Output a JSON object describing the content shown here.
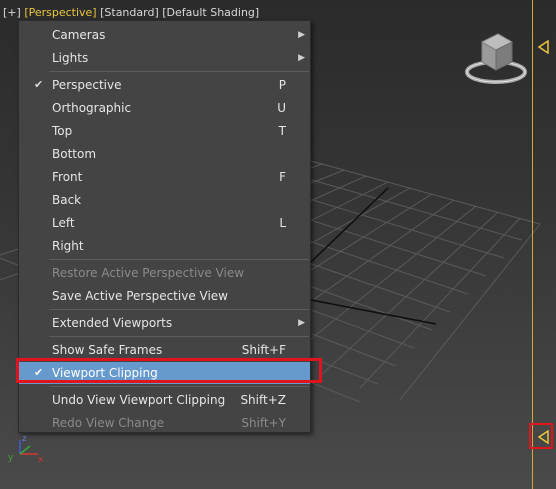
{
  "viewport_label": {
    "plus": "[+]",
    "view": "[Perspective]",
    "mode": "[Standard]",
    "shading": "[Default Shading]"
  },
  "menu": {
    "cameras": "Cameras",
    "lights": "Lights",
    "perspective": "Perspective",
    "perspective_sc": "P",
    "orthographic": "Orthographic",
    "orthographic_sc": "U",
    "top": "Top",
    "top_sc": "T",
    "bottom": "Bottom",
    "front": "Front",
    "front_sc": "F",
    "back": "Back",
    "left": "Left",
    "left_sc": "L",
    "right": "Right",
    "restore": "Restore Active Perspective View",
    "save": "Save Active Perspective View",
    "extended": "Extended Viewports",
    "safe_frames": "Show Safe Frames",
    "safe_frames_sc": "Shift+F",
    "clipping": "Viewport Clipping",
    "undo": "Undo View Viewport Clipping",
    "undo_sc": "Shift+Z",
    "redo": "Redo View Change",
    "redo_sc": "Shift+Y"
  },
  "axis": {
    "x": "x",
    "y": "y",
    "z": "z"
  },
  "colors": {
    "accent": "#e8c63c",
    "highlight": "#6699cc",
    "annotation": "#e0141c"
  },
  "icons": {
    "check": "check-icon",
    "submenu": "submenu-arrow-icon",
    "viewcube": "viewcube-icon",
    "clip_handle": "clip-handle-icon"
  }
}
